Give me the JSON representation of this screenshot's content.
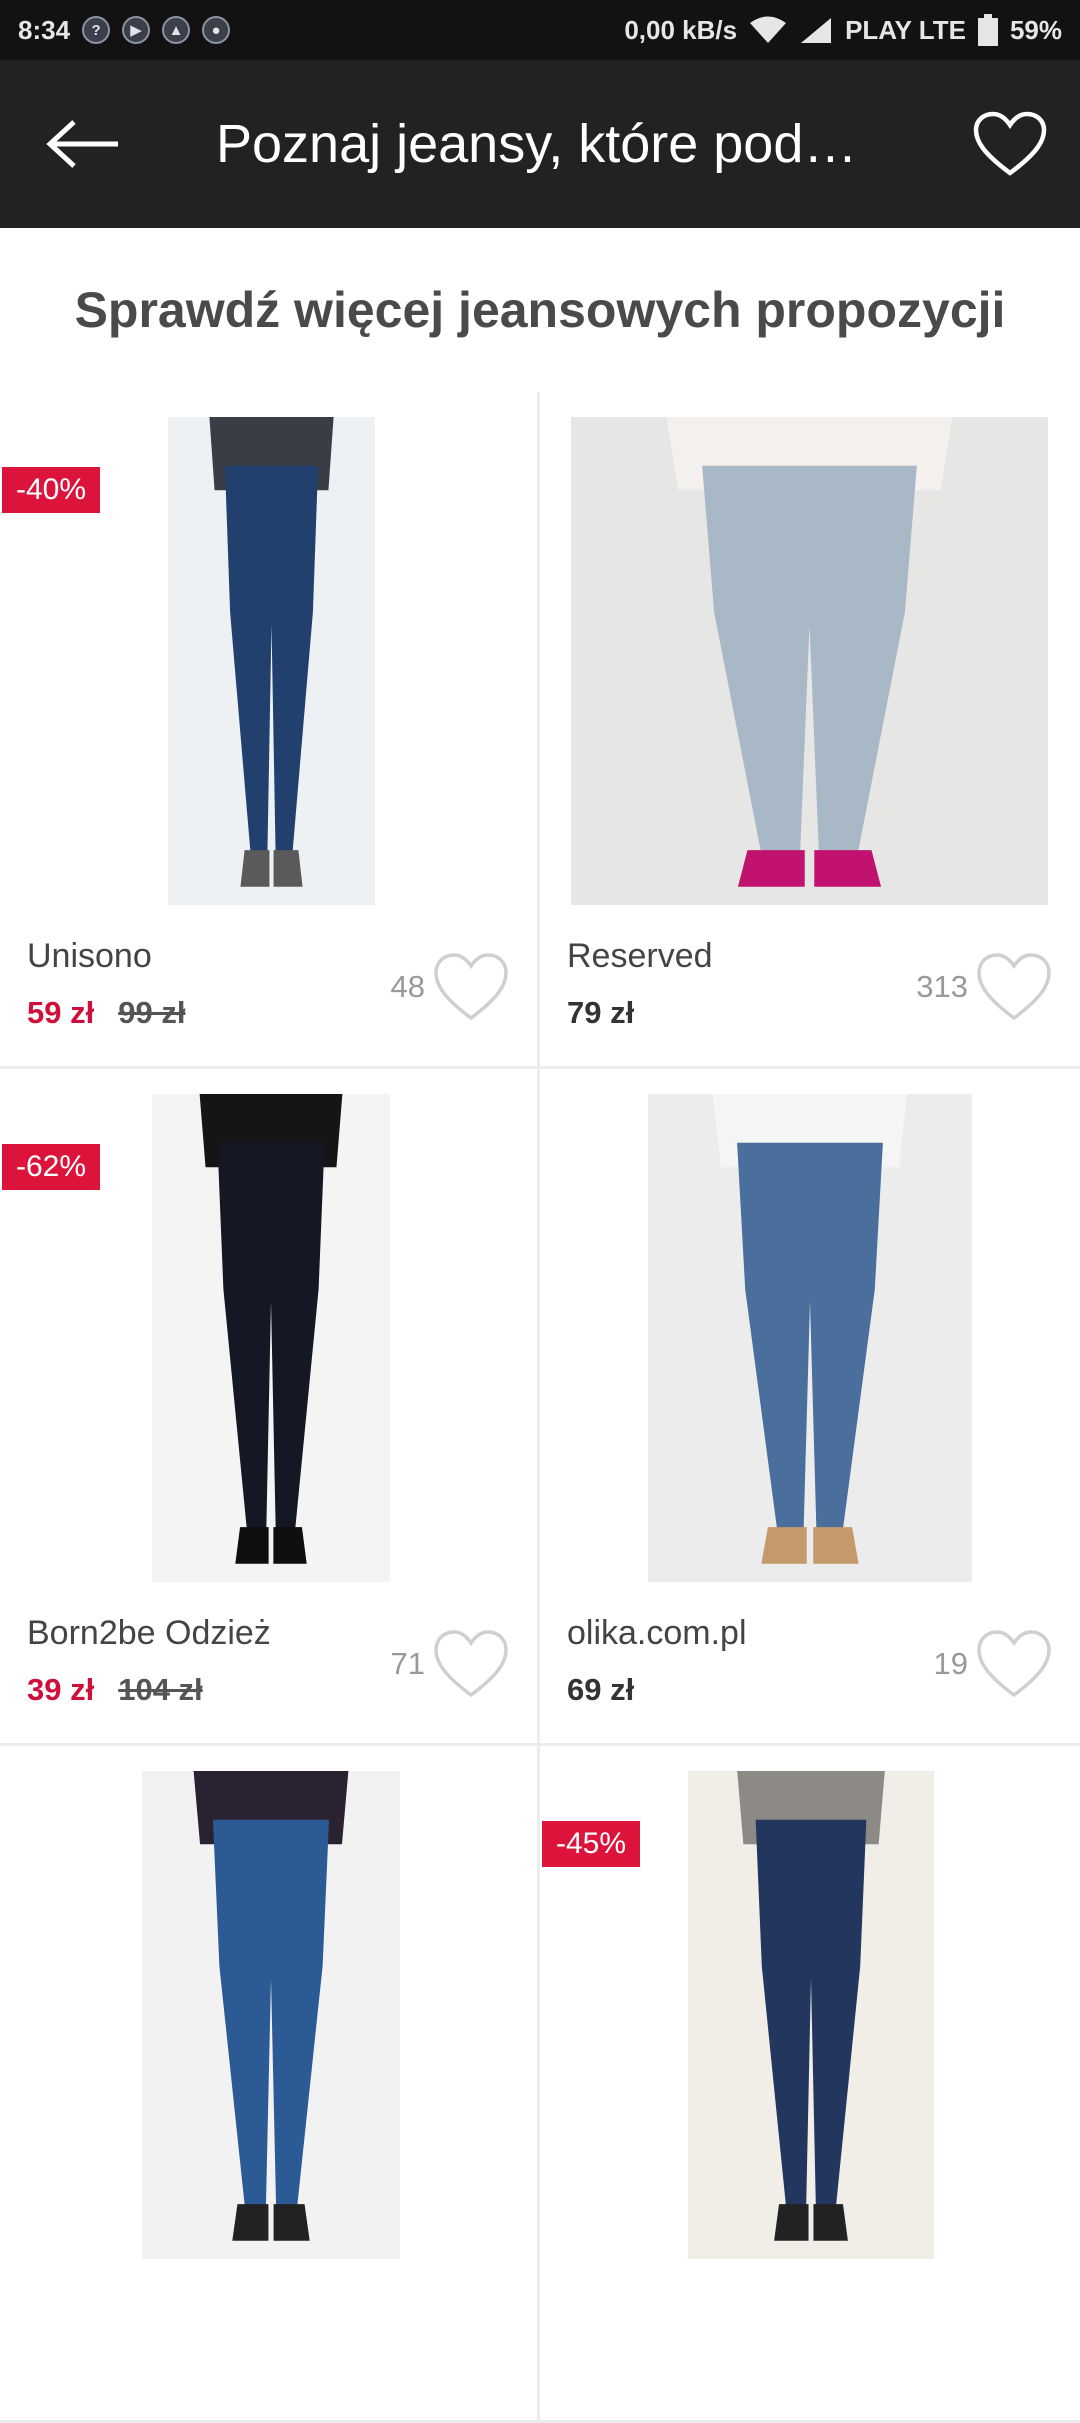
{
  "status_bar": {
    "time": "8:34",
    "speed": "0,00 kB/s",
    "carrier": "PLAY LTE",
    "battery": "59%"
  },
  "app_bar": {
    "title": "Poznaj jeansy, które pod…"
  },
  "section": {
    "heading": "Sprawdź więcej jeansowych propozycji"
  },
  "products": [
    {
      "brand": "Unisono",
      "price": "59 zł",
      "old_price": "99 zł",
      "discount": "-40%",
      "likes": "48",
      "jeans_color": "#22406e",
      "top_color": "#3a3d44",
      "shoe_color": "#5a5a5a",
      "bg_color": "#eef1f4"
    },
    {
      "brand": "Reserved",
      "price": "79 zł",
      "old_price": "",
      "discount": "",
      "likes": "313",
      "jeans_color": "#a9b8c6",
      "top_color": "#f3f0ee",
      "shoe_color": "#c0126e",
      "bg_color": "#e6e6e4"
    },
    {
      "brand": "Born2be Odzież",
      "price": "39 zł",
      "old_price": "104 zł",
      "discount": "-62%",
      "likes": "71",
      "jeans_color": "#141724",
      "top_color": "#151515",
      "shoe_color": "#0e0e0e",
      "bg_color": "#f4f4f2"
    },
    {
      "brand": "olika.com.pl",
      "price": "69 zł",
      "old_price": "",
      "discount": "",
      "likes": "19",
      "jeans_color": "#4b6f9c",
      "top_color": "#f5f5f5",
      "shoe_color": "#c49a6c",
      "bg_color": "#ececec"
    },
    {
      "brand": "",
      "price": "",
      "old_price": "",
      "discount": "",
      "likes": "",
      "jeans_color": "#2b5a94",
      "top_color": "#2a2230",
      "shoe_color": "#222",
      "bg_color": "#f2f2f2"
    },
    {
      "brand": "",
      "price": "",
      "old_price": "",
      "discount": "-45%",
      "likes": "",
      "jeans_color": "#23365e",
      "top_color": "#8d8a85",
      "shoe_color": "#222",
      "bg_color": "#f1eee8"
    }
  ],
  "colors": {
    "accent": "#dc143c",
    "appbar": "#222222",
    "statusbar": "#121212"
  }
}
